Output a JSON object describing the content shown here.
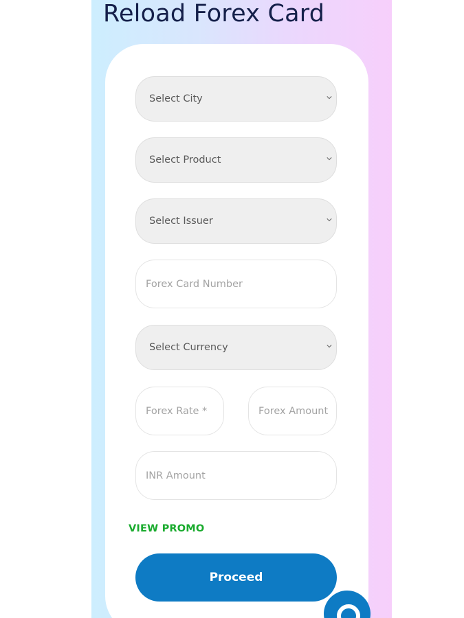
{
  "page": {
    "title": "Reload Forex Card"
  },
  "form": {
    "city_select": {
      "value": "Select City"
    },
    "product_select": {
      "value": "Select Product"
    },
    "issuer_select": {
      "value": "Select Issuer"
    },
    "card_number_input": {
      "placeholder": "Forex Card Number"
    },
    "currency_select": {
      "value": "Select Currency"
    },
    "forex_rate_input": {
      "placeholder": "Forex Rate *"
    },
    "forex_amount_input": {
      "placeholder": "Forex Amount"
    },
    "inr_amount_input": {
      "placeholder": "INR Amount"
    },
    "view_promo_label": "VIEW PROMO",
    "proceed_label": "Proceed"
  },
  "icons": {
    "dropdown": "chevron-down-icon",
    "chat": "chat-icon"
  },
  "colors": {
    "title": "#15204a",
    "accent": "#0e7bc4",
    "promo": "#1aab2e",
    "field_bg": "#efefef",
    "gradient_left": "#cdeefe",
    "gradient_right": "#f7cffb"
  }
}
